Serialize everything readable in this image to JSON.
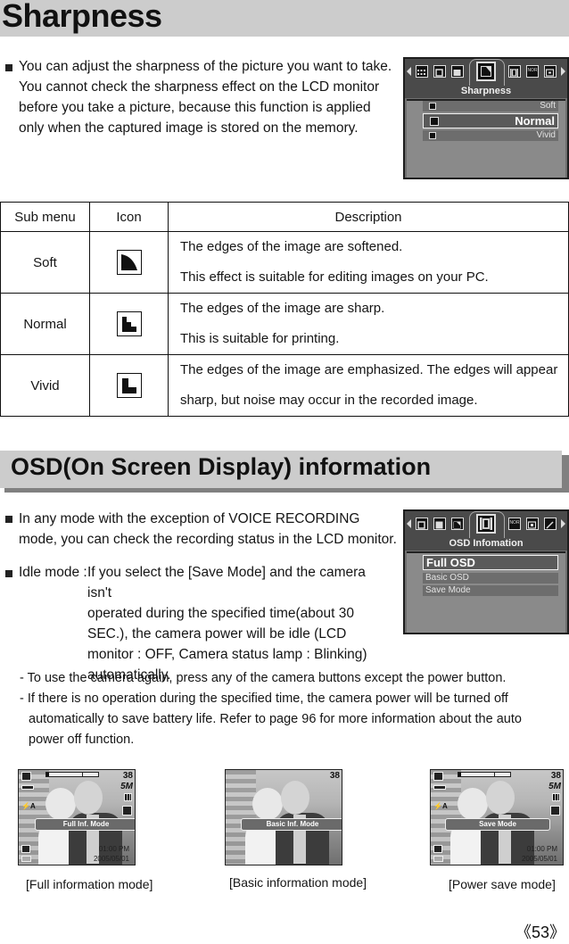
{
  "page_title": "Sharpness",
  "sharpness_intro": [
    "You can adjust the sharpness of the picture you want to take.",
    "You cannot check the sharpness effect on the LCD monitor",
    "before you take a picture, because this function is applied",
    "only when the captured image is stored on the memory."
  ],
  "sharpness_menu": {
    "title": "Sharpness",
    "options": [
      {
        "label": "Soft",
        "selected": false
      },
      {
        "label": "Normal",
        "selected": true
      },
      {
        "label": "Vivid",
        "selected": false
      }
    ],
    "tab_icons": [
      "arrow-left-icon",
      "grid-icon",
      "frame-icon",
      "solid-frame-icon",
      "sharpness-icon",
      "osd-icon",
      "nor-icon",
      "sub-frame-icon",
      "arrow-right-icon"
    ],
    "nor_label": "NOR"
  },
  "table": {
    "headers": [
      "Sub menu",
      "Icon",
      "Description"
    ],
    "rows": [
      {
        "submenu": "Soft",
        "icon": "sharpness-soft-icon",
        "desc": [
          "The edges of the image are softened.",
          "This effect is suitable for editing images on your PC."
        ]
      },
      {
        "submenu": "Normal",
        "icon": "sharpness-normal-icon",
        "desc": [
          "The edges of the image are sharp.",
          "This is suitable for printing."
        ]
      },
      {
        "submenu": "Vivid",
        "icon": "sharpness-vivid-icon",
        "desc": [
          "The edges of the image are emphasized. The edges will appear",
          "sharp, but noise may occur in the recorded image."
        ]
      }
    ]
  },
  "osd_section_title": "OSD(On Screen Display) information",
  "osd_intro": [
    "In any mode with the exception of VOICE RECORDING",
    "mode, you can check the recording status in the LCD monitor."
  ],
  "idle_mode": {
    "label": "Idle mode :",
    "lines": [
      "If you select the [Save Mode] and the camera isn't",
      "operated during the specified time(about 30",
      "SEC.), the camera power will be idle (LCD",
      "monitor : OFF, Camera status lamp : Blinking)",
      "automatically."
    ]
  },
  "notes": [
    "- To use the camera again, press any of the camera buttons except the power button.",
    "- If there is no operation during the specified time, the camera power will be turned off",
    "automatically to save battery life. Refer to page 96 for more information about the auto",
    "power off function."
  ],
  "osd_menu": {
    "title": "OSD Infomation",
    "options": [
      {
        "label": "Full OSD",
        "selected": true
      },
      {
        "label": "Basic OSD",
        "selected": false
      },
      {
        "label": "Save Mode",
        "selected": false
      }
    ],
    "nor_label": "NOR"
  },
  "screens": [
    {
      "mode_label": "Full Inf. Mode",
      "shots": "38",
      "resolution": "5M",
      "time": "01:00 PM",
      "date": "2005/05/01",
      "caption": "[Full information mode]",
      "full": true
    },
    {
      "mode_label": "Basic Inf. Mode",
      "shots": "38",
      "caption": "[Basic information mode]",
      "full": false
    },
    {
      "mode_label": "Save Mode",
      "shots": "38",
      "resolution": "5M",
      "time": "01:00 PM",
      "date": "2005/05/01",
      "caption": "[Power save mode]",
      "full": true
    }
  ],
  "page_number": "《53》"
}
